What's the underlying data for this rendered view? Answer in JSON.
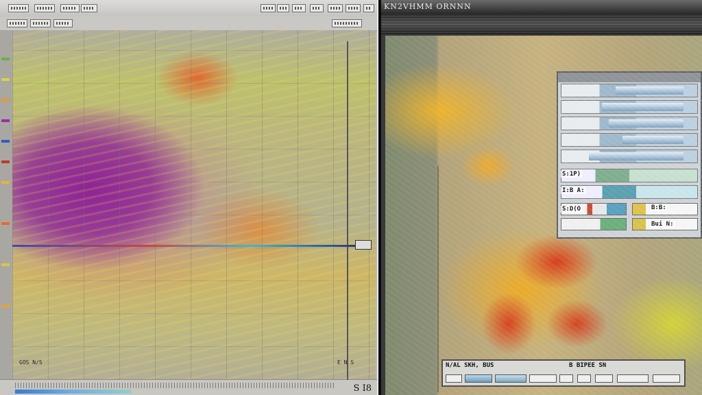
{
  "left_window": {
    "plot_readout_left": "GOS N/S",
    "plot_readout_right": "E N S",
    "status_label": "S I8"
  },
  "right_window": {
    "title": "KN2VHMM ORNNN",
    "inset": {
      "row_label_1": "S:1P)",
      "row_label_2": "I:B A:",
      "row_label_3": "S:D(O",
      "row_label_4": "B:B:",
      "row_label_5": "Bui N:"
    },
    "bottom_bar": {
      "label_left": "N/AL  SKH, BUS",
      "label_right": "B  BIPEE SN"
    }
  }
}
